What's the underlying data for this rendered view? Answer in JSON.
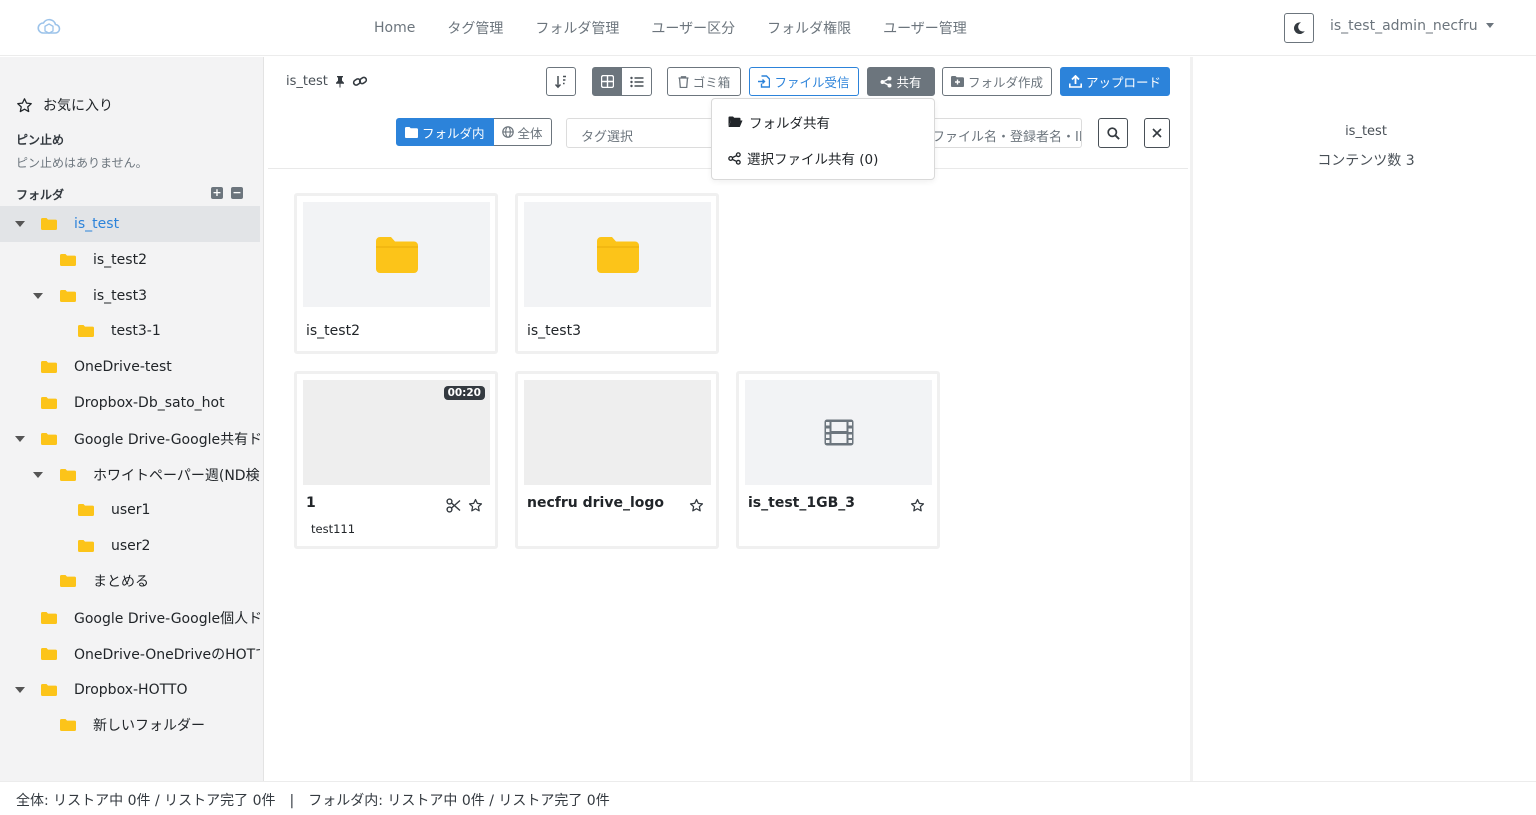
{
  "nav": {
    "links": [
      "Home",
      "タグ管理",
      "フォルダ管理",
      "ユーザー区分",
      "フォルダ権限",
      "ユーザー管理"
    ],
    "user": "is_test_admin_necfru"
  },
  "sidebar": {
    "favorites": "お気に入り",
    "pinned_title": "ピン止め",
    "pinned_empty": "ピン止めはありません。",
    "folder_title": "フォルダ",
    "tree": [
      {
        "label": "is_test"
      },
      {
        "label": "is_test2"
      },
      {
        "label": "is_test3"
      },
      {
        "label": "test3-1"
      },
      {
        "label": "OneDrive-test"
      },
      {
        "label": "Dropbox-Db_sato_hot"
      },
      {
        "label": "Google Drive-Google共有ドライブ"
      },
      {
        "label": "ホワイトペーパー週(ND検"
      },
      {
        "label": "user1"
      },
      {
        "label": "user2"
      },
      {
        "label": "まとめる"
      },
      {
        "label": "Google Drive-Google個人ドライブ"
      },
      {
        "label": "OneDrive-OneDriveのHOTで"
      },
      {
        "label": "Dropbox-HOTTO"
      },
      {
        "label": "新しいフォルダー"
      }
    ]
  },
  "toolbar": {
    "breadcrumb": "is_test",
    "trash": "ゴミ箱",
    "receive": "ファイル受信",
    "share": "共有",
    "create_folder": "フォルダ作成",
    "upload": "アップロード",
    "scope_folder": "フォルダ内",
    "scope_all": "全体",
    "tag_placeholder": "タグ選択",
    "search_placeholder": "ファイル名・登録者名・ID"
  },
  "share_menu": {
    "folder_share": "フォルダ共有",
    "selected_share": "選択ファイル共有 (0)"
  },
  "cards": [
    {
      "title": "is_test2"
    },
    {
      "title": "is_test3"
    },
    {
      "title": "1",
      "duration": "00:20",
      "tag": "test111"
    },
    {
      "title": "necfru drive_logo"
    },
    {
      "title": "is_test_1GB_3"
    }
  ],
  "right_panel": {
    "name": "is_test",
    "count": "コンテンツ数 3"
  },
  "footer": "全体: リストア中 0件 / リストア完了 0件　|　フォルダ内: リストア中 0件 / リストア完了 0件",
  "colors": {
    "accent": "#2c83da",
    "folder": "#fcc419",
    "secondary": "#6c757d"
  }
}
